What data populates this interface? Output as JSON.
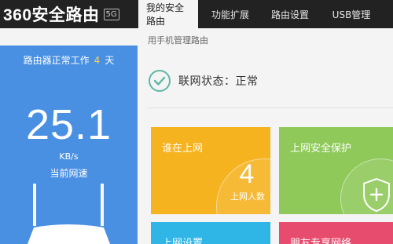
{
  "header": {
    "brand": "360安全路由",
    "badge": "5G",
    "tabs": [
      {
        "label": "我的安全路由",
        "active": true
      },
      {
        "label": "功能扩展",
        "active": false
      },
      {
        "label": "路由设置",
        "active": false
      },
      {
        "label": "USB管理",
        "active": false
      }
    ]
  },
  "subtitle": "用手机管理路由",
  "left_panel": {
    "status_prefix": "路由器正常工作",
    "days": "4",
    "status_suffix": "天",
    "speed": "25.1",
    "unit": "KB/s",
    "speed_label": "当前网速"
  },
  "network_status": "联网状态：正常",
  "tiles": {
    "who_online": {
      "title": "谁在上网",
      "count": "4",
      "count_label": "上网人数"
    },
    "security": {
      "title": "上网安全保护"
    },
    "net_settings": {
      "title": "上网设置"
    },
    "friend_network": {
      "title": "朋友专享网络"
    }
  },
  "colors": {
    "topbar": "#222222",
    "left_panel": "#4a90e2",
    "orange_tile": "#f5b320",
    "green_tile": "#8fc95a",
    "blue_tile": "#2fb6e6",
    "pink_tile": "#e74c6e",
    "accent_days": "#ffd24d",
    "check": "#5fb7a6"
  },
  "icons": {
    "check": "check-circle-icon",
    "shield": "shield-plus-icon",
    "router": "router-icon"
  }
}
